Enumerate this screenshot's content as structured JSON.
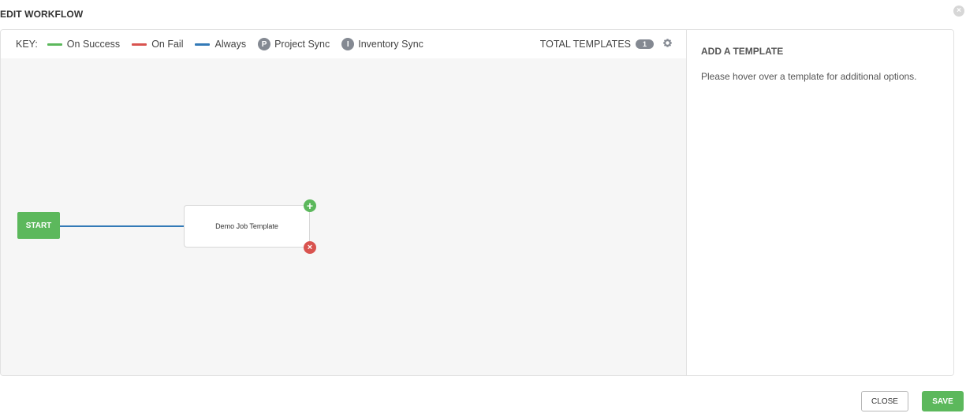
{
  "modal": {
    "title": "EDIT WORKFLOW",
    "close_icon": "×"
  },
  "key": {
    "label": "KEY:",
    "items": [
      {
        "label": "On Success",
        "color": "#5cb85c"
      },
      {
        "label": "On Fail",
        "color": "#d9534f"
      },
      {
        "label": "Always",
        "color": "#337ab7"
      }
    ],
    "project_sync": {
      "badge": "P",
      "label": "Project Sync"
    },
    "inventory_sync": {
      "badge": "I",
      "label": "Inventory Sync"
    }
  },
  "totals": {
    "label": "TOTAL TEMPLATES",
    "count": "1",
    "settings_icon": "gear-icon"
  },
  "graph": {
    "start_label": "START",
    "node_label": "Demo Job Template",
    "add_icon": "+",
    "remove_icon": "×"
  },
  "side_panel": {
    "title": "ADD A TEMPLATE",
    "hint": "Please hover over a template for additional options."
  },
  "footer": {
    "close_label": "CLOSE",
    "save_label": "SAVE"
  }
}
